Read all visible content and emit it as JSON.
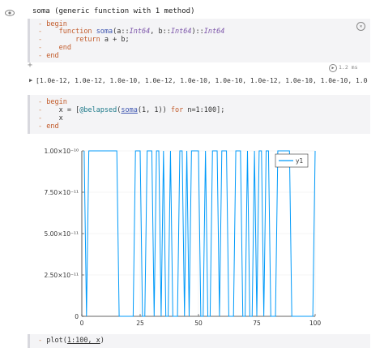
{
  "cell1": {
    "output_text": "soma (generic function with 1 method)",
    "code": {
      "begin": "begin",
      "function_kw": "function",
      "fn_name": "soma",
      "arg1": "(a::",
      "type1": "Int64",
      "sep": ", b::",
      "type2": "Int64",
      "close": ")::",
      "ret_type": "Int64",
      "return_kw": "return",
      "return_expr": " a + b;",
      "end_inner": "end",
      "end_outer": "end"
    }
  },
  "cell2": {
    "runtime": "1.2 ms",
    "output": "[1.0e-12, 1.0e-12, 1.0e-10, 1.0e-12, 1.0e-10, 1.0e-10, 1.0e-12, 1.0e-10, 1.0e-10, 1.0e-10, 1.0e-10, 1.0e-12,",
    "code": {
      "begin": "begin",
      "assign": "x = [",
      "macro": "@belapsed",
      "call": "soma",
      "args": "(1, 1)",
      "loop_kw": "for",
      "loop": " n=1:100];",
      "x": "x",
      "end": "end"
    }
  },
  "cell3": {
    "code_prefix": "plot(",
    "code_args": "1:100, x",
    "code_suffix": ")"
  },
  "chart_data": {
    "type": "line",
    "series": [
      {
        "name": "y1",
        "color": "#009af9",
        "values": [
          1e-10,
          0,
          1e-10,
          1e-10,
          1e-10,
          1e-10,
          1e-10,
          1e-10,
          1e-10,
          1e-10,
          1e-10,
          1e-10,
          1e-10,
          1e-10,
          1e-10,
          0,
          0,
          0,
          0,
          0,
          0,
          0,
          1e-10,
          1e-10,
          1e-10,
          0,
          0,
          1e-10,
          1e-10,
          1e-10,
          0,
          1e-10,
          1e-10,
          0,
          1e-10,
          0,
          0,
          1e-10,
          0,
          0,
          0,
          1e-10,
          1e-10,
          0,
          1e-10,
          0,
          1e-10,
          1e-10,
          1e-10,
          1e-10,
          0,
          0,
          1e-10,
          0,
          0,
          1e-10,
          1e-10,
          1e-10,
          0,
          1e-10,
          1e-10,
          1e-10,
          0,
          0,
          0,
          1e-10,
          1e-10,
          1e-10,
          0,
          0,
          1e-10,
          0,
          0,
          1e-10,
          0,
          1e-10,
          1e-10,
          0,
          1e-10,
          1e-10,
          0,
          0,
          0,
          1e-10,
          1e-10,
          1e-10,
          1e-10,
          1e-10,
          1e-10,
          0,
          0,
          0,
          0,
          0,
          0,
          0,
          0,
          0,
          0,
          1e-10
        ]
      }
    ],
    "x": {
      "start": 1,
      "end": 100
    },
    "xticks": [
      "0",
      "25",
      "50",
      "75",
      "100"
    ],
    "xtick_values": [
      0,
      25,
      50,
      75,
      100
    ],
    "yticks": [
      "0",
      "2.50×10⁻¹¹",
      "5.00×10⁻¹¹",
      "7.50×10⁻¹¹",
      "1.00×10⁻¹⁰"
    ],
    "ytick_values": [
      0,
      2.5e-11,
      5e-11,
      7.5e-11,
      1e-10
    ],
    "xlim": [
      0,
      100
    ],
    "ylim": [
      0,
      1e-10
    ],
    "legend": "top-right",
    "grid": true
  },
  "icons": {
    "eye": "eye-icon",
    "gear": "gear-icon",
    "run": "run-icon",
    "expand": "expand-triangle-icon"
  }
}
